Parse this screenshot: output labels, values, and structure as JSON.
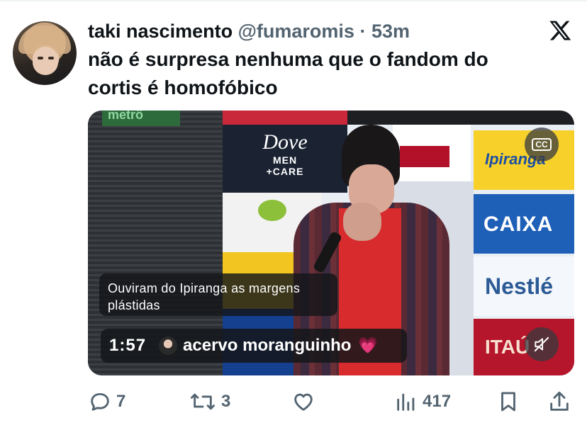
{
  "tweet": {
    "author": {
      "display_name": "taki nascimento",
      "handle": "@fumaromis",
      "separator": "·",
      "time": "53m"
    },
    "text": "não é surpresa nenhuma que o fandom do cortis é homofóbico",
    "platform_icon": "x-logo-icon"
  },
  "media": {
    "type": "video",
    "cc_label": "CC",
    "caption": "Ouviram do Ipiranga as margens plástidas",
    "duration": "1:57",
    "source_name": "acervo moranguinho",
    "source_emoji": "💗",
    "muted": true,
    "background_signage": {
      "banner": "metrô",
      "dove_line1": "Dove",
      "dove_line2": "MEN",
      "dove_line3": "+CARE",
      "ipiranga": "Ipiranga",
      "caixa": "CAIXA",
      "nestle": "Nestlé",
      "itau": "ITAÚ"
    }
  },
  "actions": {
    "replies": "7",
    "reposts": "3",
    "likes": "",
    "views": "417"
  },
  "colors": {
    "text_primary": "#0f1419",
    "text_secondary": "#536471",
    "background": "#ffffff"
  }
}
